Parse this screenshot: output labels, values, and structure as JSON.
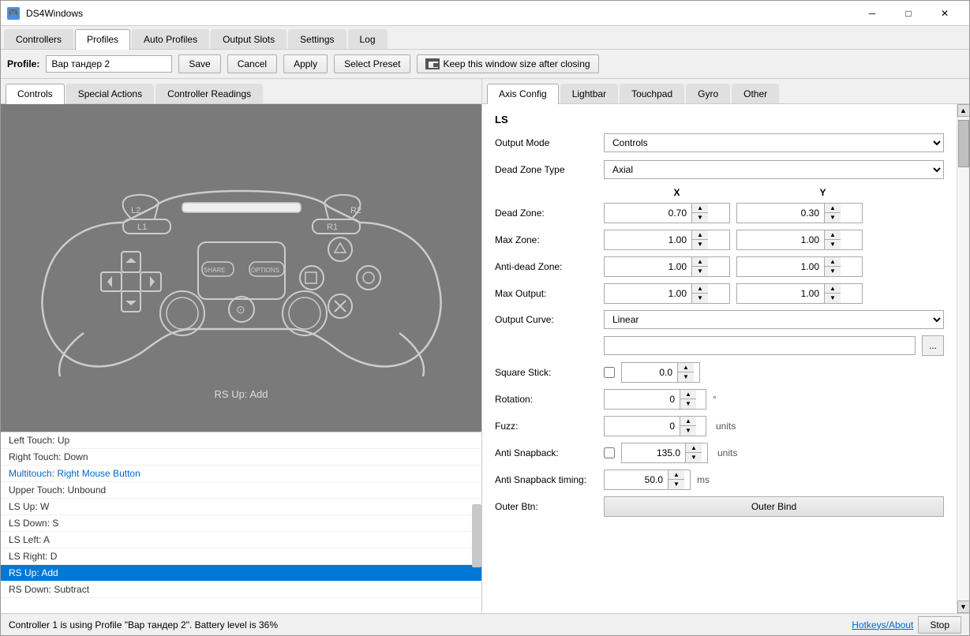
{
  "window": {
    "title": "DS4Windows",
    "icon": "🎮"
  },
  "menu_tabs": [
    {
      "label": "Controllers",
      "active": false
    },
    {
      "label": "Profiles",
      "active": true
    },
    {
      "label": "Auto Profiles",
      "active": false
    },
    {
      "label": "Output Slots",
      "active": false
    },
    {
      "label": "Settings",
      "active": false
    },
    {
      "label": "Log",
      "active": false
    }
  ],
  "toolbar": {
    "profile_label": "Profile:",
    "profile_value": "Вар тандер 2",
    "save_label": "Save",
    "cancel_label": "Cancel",
    "apply_label": "Apply",
    "select_preset_label": "Select Preset",
    "keep_size_label": "Keep this window size after closing"
  },
  "left_tabs": [
    {
      "label": "Controls",
      "active": true
    },
    {
      "label": "Special Actions",
      "active": false
    },
    {
      "label": "Controller Readings",
      "active": false
    }
  ],
  "controller": {
    "rs_label": "RS Up: Add"
  },
  "bindings": [
    {
      "text": "Left Touch: Up",
      "style": "normal"
    },
    {
      "text": "Right Touch: Down",
      "style": "normal"
    },
    {
      "text": "Multitouch: Right Mouse Button",
      "style": "normal"
    },
    {
      "text": "Upper Touch: Unbound",
      "style": "normal"
    },
    {
      "text": "LS Up: W",
      "style": "normal"
    },
    {
      "text": "LS Down: S",
      "style": "normal"
    },
    {
      "text": "LS Left: A",
      "style": "normal"
    },
    {
      "text": "LS Right: D",
      "style": "normal"
    },
    {
      "text": "RS Up: Add",
      "style": "highlighted"
    },
    {
      "text": "RS Down: Subtract",
      "style": "normal"
    }
  ],
  "right_tabs": [
    {
      "label": "Axis Config",
      "active": true
    },
    {
      "label": "Lightbar",
      "active": false
    },
    {
      "label": "Touchpad",
      "active": false
    },
    {
      "label": "Gyro",
      "active": false
    },
    {
      "label": "Other",
      "active": false
    }
  ],
  "axis_config": {
    "section_title": "LS",
    "output_mode_label": "Output Mode",
    "output_mode_value": "Controls",
    "dead_zone_type_label": "Dead Zone Type",
    "dead_zone_type_value": "Axial",
    "x_header": "X",
    "y_header": "Y",
    "dead_zone_label": "Dead Zone:",
    "dead_zone_x": "0.70",
    "dead_zone_y": "0.30",
    "max_zone_label": "Max Zone:",
    "max_zone_x": "1.00",
    "max_zone_y": "1.00",
    "anti_dead_zone_label": "Anti-dead Zone:",
    "anti_dead_zone_x": "1.00",
    "anti_dead_zone_y": "1.00",
    "max_output_label": "Max Output:",
    "max_output_x": "1.00",
    "max_output_y": "1.00",
    "output_curve_label": "Output Curve:",
    "output_curve_value": "Linear",
    "square_stick_label": "Square Stick:",
    "square_stick_value": "0.0",
    "rotation_label": "Rotation:",
    "rotation_value": "0",
    "rotation_unit": "°",
    "fuzz_label": "Fuzz:",
    "fuzz_value": "0",
    "fuzz_unit": "units",
    "anti_snapback_label": "Anti Snapback:",
    "anti_snapback_value": "135.0",
    "anti_snapback_unit": "units",
    "anti_snapback_timing_label": "Anti Snapback timing:",
    "anti_snapback_timing_value": "50.0",
    "anti_snapback_timing_unit": "ms",
    "outer_btn_label": "Outer Btn:",
    "outer_bind_label": "Outer Bind"
  },
  "status_bar": {
    "text": "Controller 1 is using Profile \"Вар тандер 2\". Battery level is 36%",
    "hotkeys_label": "Hotkeys/About",
    "stop_label": "Stop"
  }
}
